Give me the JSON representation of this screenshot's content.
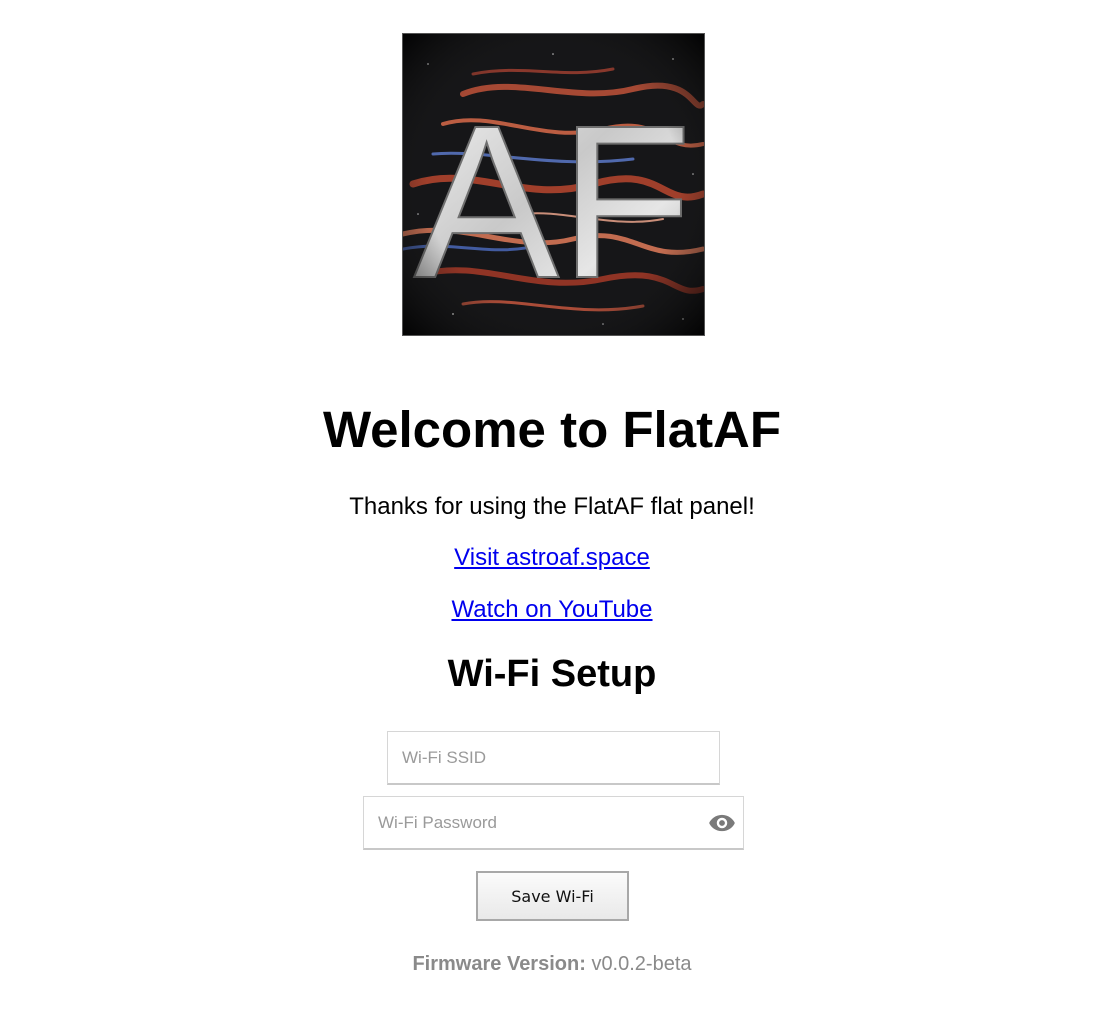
{
  "logo": {
    "text": "AF"
  },
  "heading": "Welcome to FlatAF",
  "subtitle": "Thanks for using the FlatAF flat panel!",
  "links": {
    "site": "Visit astroaf.space",
    "youtube": "Watch on YouTube"
  },
  "wifi": {
    "title": "Wi-Fi Setup",
    "ssid_placeholder": "Wi-Fi SSID",
    "ssid_value": "",
    "password_placeholder": "Wi-Fi Password",
    "password_value": "",
    "toggle_icon": "eye-icon",
    "save_label": "Save Wi-Fi"
  },
  "firmware": {
    "label": "Firmware Version:",
    "version": "v0.0.2-beta"
  },
  "colors": {
    "link": "#0000ee",
    "muted": "#8a8a8a"
  }
}
